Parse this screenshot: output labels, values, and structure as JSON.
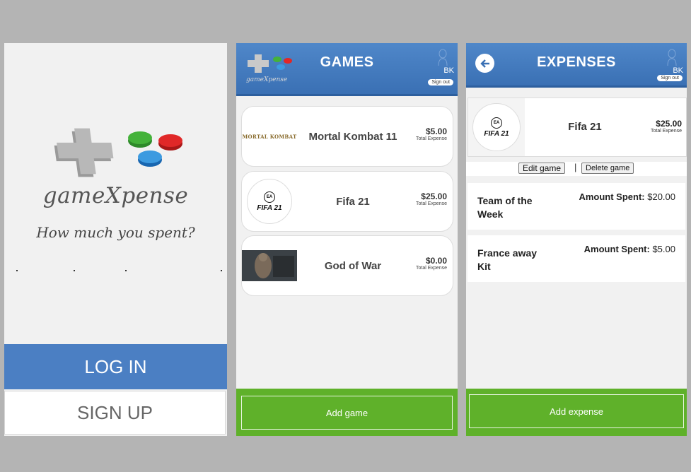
{
  "login_screen": {
    "app_name": "gameXpense",
    "tagline": "How much you spent?",
    "login_label": "LOG IN",
    "signup_label": "SIGN UP"
  },
  "games_screen": {
    "title": "GAMES",
    "user_initials": "BK",
    "signout_label": "Sign out",
    "games": [
      {
        "name": "Mortal Kombat 11",
        "amount": "$5.00",
        "amount_label": "Total Expense",
        "thumb_text": "MORTAL KOMBAT"
      },
      {
        "name": "Fifa 21",
        "amount": "$25.00",
        "amount_label": "Total Expense",
        "thumb_text": "FIFA 21"
      },
      {
        "name": "God of War",
        "amount": "$0.00",
        "amount_label": "Total Expense"
      }
    ],
    "add_label": "Add game"
  },
  "expenses_screen": {
    "title": "EXPENSES",
    "user_initials": "BK",
    "signout_label": "Sign out",
    "game": {
      "name": "Fifa 21",
      "amount": "$25.00",
      "amount_label": "Total Expense",
      "thumb_text": "FIFA 21"
    },
    "edit_label": "Edit game",
    "separator": "|",
    "delete_label": "Delete game",
    "expenses": [
      {
        "name": "Team of the Week",
        "spent_label": "Amount Spent:",
        "spent_value": "$20.00"
      },
      {
        "name": "France away Kit",
        "spent_label": "Amount Spent:",
        "spent_value": "$5.00"
      }
    ],
    "add_label": "Add expense"
  },
  "colors": {
    "header_blue": "#4a80c4",
    "login_blue": "#4b7fc3",
    "action_green": "#5fb12a",
    "panel_bg": "#f1f1f1",
    "page_bg": "#b4b4b4"
  },
  "icons": [
    "dpad-logo-icon",
    "user-silhouette-icon",
    "back-arrow-icon",
    "ea-logo-icon"
  ]
}
